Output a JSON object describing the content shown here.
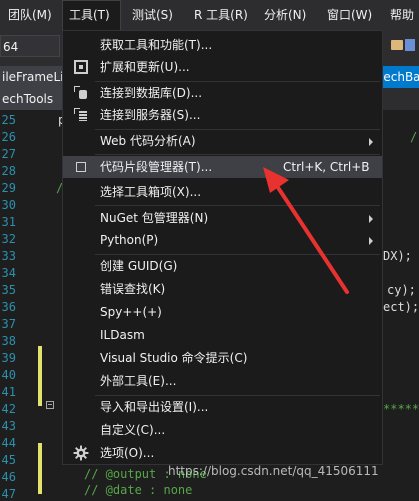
{
  "menubar": {
    "items": [
      {
        "label": "团队(M)"
      },
      {
        "label": "工具(T)",
        "active": true
      },
      {
        "label": "测试(S)"
      },
      {
        "label": "R 工具(R)"
      },
      {
        "label": "分析(N)"
      },
      {
        "label": "窗口(W)"
      },
      {
        "label": "帮助"
      }
    ]
  },
  "toolbar": {
    "config_value": "64"
  },
  "tabs": {
    "left": "ileFrameLis",
    "right": "MechBa",
    "left2": "echTools"
  },
  "editor": {
    "line_numbers": [
      "25",
      "26",
      "27",
      "28",
      "29",
      "30",
      "31",
      "32",
      "33",
      "34",
      "35",
      "36",
      "37",
      "38",
      "39",
      "40",
      "41",
      "42",
      "43",
      "44",
      "45",
      "46",
      "47"
    ],
    "fragments": {
      "p_25": "p",
      "slash_26": "/",
      "slash_30": "/",
      "dx": "DX);",
      "cy": "cy);",
      "ect": "ect);",
      "stars": "*****",
      "output": "//  @output : none",
      "date": "//  @date    : none"
    }
  },
  "watermark": "https://blog.csdn.net/qq_41506111",
  "menu": {
    "items": [
      {
        "label": "获取工具和功能(T)...",
        "icon": "none"
      },
      {
        "label": "扩展和更新(U)...",
        "icon": "extensions-icon"
      },
      {
        "label": "连接到数据库(D)...",
        "icon": "connect-database-icon"
      },
      {
        "label": "连接到服务器(S)...",
        "icon": "connect-server-icon"
      },
      {
        "label": "Web 代码分析(A)",
        "submenu": true
      },
      {
        "label": "代码片段管理器(T)...",
        "shortcut": "Ctrl+K, Ctrl+B",
        "icon": "snippet-checkbox-icon",
        "highlighted": true
      },
      {
        "label": "选择工具箱项(X)..."
      },
      {
        "label": "NuGet 包管理器(N)",
        "submenu": true
      },
      {
        "label": "Python(P)",
        "submenu": true
      },
      {
        "label": "创建 GUID(G)"
      },
      {
        "label": "错误查找(K)"
      },
      {
        "label": "Spy++(+)"
      },
      {
        "label": "ILDasm"
      },
      {
        "label": "Visual Studio 命令提示(C)"
      },
      {
        "label": "外部工具(E)..."
      },
      {
        "label": "导入和导出设置(I)..."
      },
      {
        "label": "自定义(C)..."
      },
      {
        "label": "选项(O)...",
        "icon": "gear-icon"
      }
    ]
  },
  "colors": {
    "accent": "#007acc",
    "annotation_arrow": "#e8322f",
    "menu_bg": "#1b1b1c",
    "highlight": "#3f3f46"
  }
}
